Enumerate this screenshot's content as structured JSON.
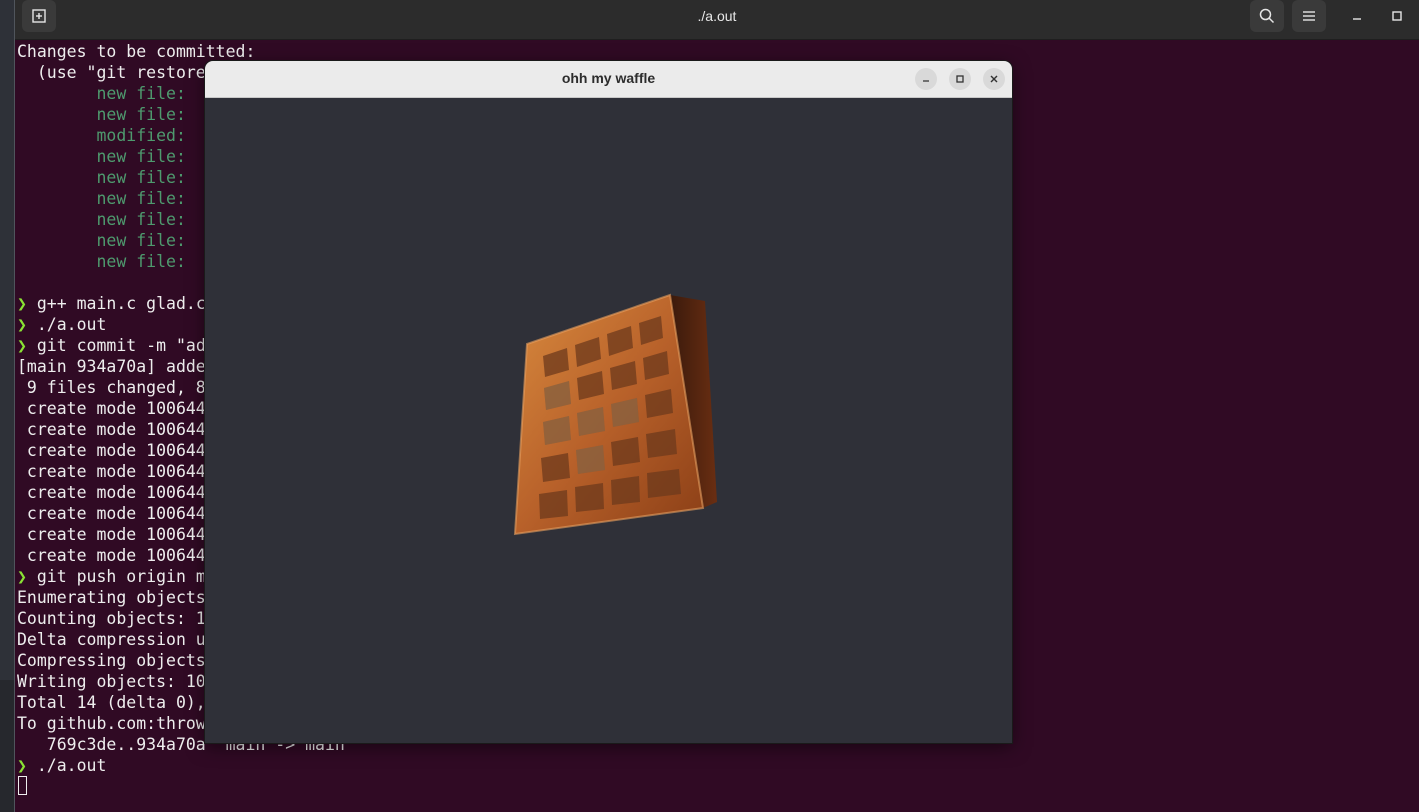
{
  "terminal": {
    "title": "./a.out",
    "lines": [
      {
        "text": "Changes to be committed:",
        "cls": ""
      },
      {
        "text": "  (use \"git restore",
        "cls": ""
      },
      {
        "text": "        new file:",
        "cls": "green"
      },
      {
        "text": "        new file:",
        "cls": "green"
      },
      {
        "text": "        modified:",
        "cls": "green"
      },
      {
        "text": "        new file:",
        "cls": "green"
      },
      {
        "text": "        new file:",
        "cls": "green"
      },
      {
        "text": "        new file:",
        "cls": "green"
      },
      {
        "text": "        new file:",
        "cls": "green"
      },
      {
        "text": "        new file:",
        "cls": "green"
      },
      {
        "text": "        new file:",
        "cls": "green"
      },
      {
        "text": "",
        "cls": ""
      },
      {
        "prompt": "❯",
        "text": " g++ main.c glad.c",
        "cls": ""
      },
      {
        "prompt": "❯",
        "text": " ./a.out",
        "cls": ""
      },
      {
        "prompt": "❯",
        "text": " git commit -m \"ad",
        "cls": ""
      },
      {
        "text": "[main 934a70a] adde",
        "cls": ""
      },
      {
        "text": " 9 files changed, 8",
        "cls": ""
      },
      {
        "text": " create mode 100644",
        "cls": ""
      },
      {
        "text": " create mode 100644",
        "cls": ""
      },
      {
        "text": " create mode 100644",
        "cls": ""
      },
      {
        "text": " create mode 100644",
        "cls": ""
      },
      {
        "text": " create mode 100644",
        "cls": ""
      },
      {
        "text": " create mode 100644",
        "cls": ""
      },
      {
        "text": " create mode 100644",
        "cls": ""
      },
      {
        "text": " create mode 100644",
        "cls": ""
      },
      {
        "prompt": "❯",
        "text": " git push origin m",
        "cls": ""
      },
      {
        "text": "Enumerating objects",
        "cls": ""
      },
      {
        "text": "Counting objects: 1",
        "cls": ""
      },
      {
        "text": "Delta compression u",
        "cls": ""
      },
      {
        "text": "Compressing objects",
        "cls": ""
      },
      {
        "text": "Writing objects: 10",
        "cls": ""
      },
      {
        "text": "Total 14 (delta 0),",
        "cls": ""
      },
      {
        "text": "To github.com:throw",
        "cls": ""
      },
      {
        "text": "   769c3de..934a70a  main -> main",
        "cls": ""
      },
      {
        "prompt": "❯",
        "text": " ./a.out",
        "cls": ""
      }
    ]
  },
  "glwindow": {
    "title": "ohh my waffle"
  }
}
